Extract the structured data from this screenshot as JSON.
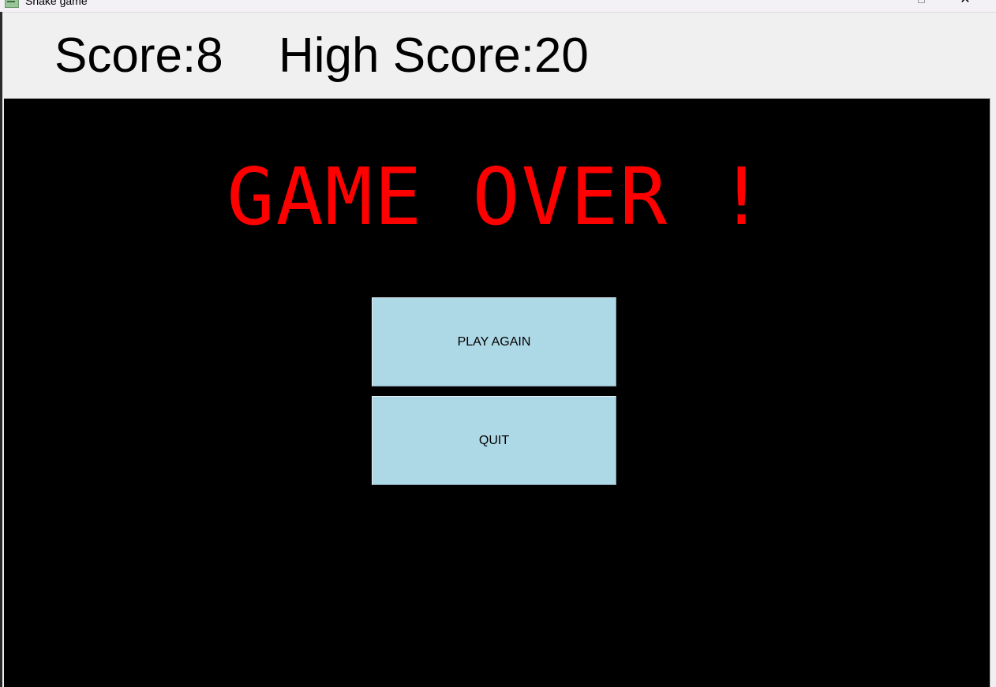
{
  "window": {
    "title": "Snake game"
  },
  "scoreboard": {
    "score_text": "Score:8",
    "high_score_text": "High Score:20"
  },
  "game": {
    "message": "GAME OVER !",
    "buttons": {
      "play_again": "PLAY AGAIN",
      "quit": "QUIT"
    }
  },
  "colors": {
    "canvas_background": "#000000",
    "message_color": "#ff0000",
    "button_color": "#add8e6",
    "scorebar_background": "#f0f0f0"
  },
  "icons": {
    "app": "snake-app-icon",
    "maximize": "maximize-icon",
    "close": "close-icon"
  }
}
